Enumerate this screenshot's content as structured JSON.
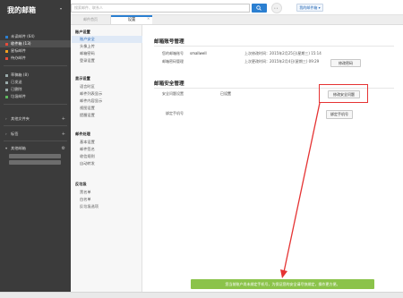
{
  "header": {
    "search_placeholder": "搜索邮件、联系人",
    "avatar_text": "• •",
    "user_button": "我的邮件箱 ▾"
  },
  "sidebar": {
    "brand": "我的邮箱",
    "items": [
      {
        "label": "未读邮件 (64)"
      },
      {
        "label": "收件箱 (13)"
      },
      {
        "label": "星标邮件"
      },
      {
        "label": "待办邮件"
      },
      {
        "label": "草稿箱 (8)"
      },
      {
        "label": "已发送"
      },
      {
        "label": "已删除"
      },
      {
        "label": "垃圾邮件"
      },
      {
        "label": "其他文件夹"
      },
      {
        "label": "标签"
      },
      {
        "label": "其他邮箱"
      }
    ]
  },
  "tabs": [
    {
      "label": "邮件首页"
    },
    {
      "label": "设置"
    }
  ],
  "settings_nav": {
    "sections": [
      {
        "title": "账户设置",
        "items": [
          "账户安全",
          "头像上传",
          "邮箱密码",
          "登录设置"
        ]
      },
      {
        "title": "显示设置",
        "items": [
          "语言时区",
          "邮件列表显示",
          "邮件内容显示",
          "视图设置",
          "提醒设置"
        ]
      },
      {
        "title": "邮件处理",
        "items": [
          "基本设置",
          "邮件签名",
          "收信规则",
          "自动转发"
        ]
      },
      {
        "title": "反垃圾",
        "items": [
          "黑名单",
          "白名单",
          "反垃圾选项"
        ]
      }
    ]
  },
  "password_section": {
    "title": "邮箱账号管理",
    "rows": [
      {
        "label": "您的邮箱账号",
        "value": "smallwell",
        "extra": "上次修改时间：2015年2月25日(星期三) 15:14"
      },
      {
        "label": "邮箱密码管理",
        "value": "",
        "extra": "上次更改时间：2015年2月4日(星期三) 09:29"
      }
    ],
    "button": "修改密码"
  },
  "security_section": {
    "title": "邮箱安全管理",
    "question_label": "安全问题设置",
    "question_status": "已设置",
    "question_button": "修改安全问题",
    "phone_label": "绑定手机号",
    "phone_button": "绑定手机号"
  },
  "tip": "您当前账户尚未绑定手机号，为保证您的安全请尽快绑定，操作更方便。",
  "colors": {
    "accent": "#2b7fd1",
    "sidebar_bg": "#3b3b3b",
    "highlight": "#e53333",
    "tip_bg": "#8bc34a"
  }
}
